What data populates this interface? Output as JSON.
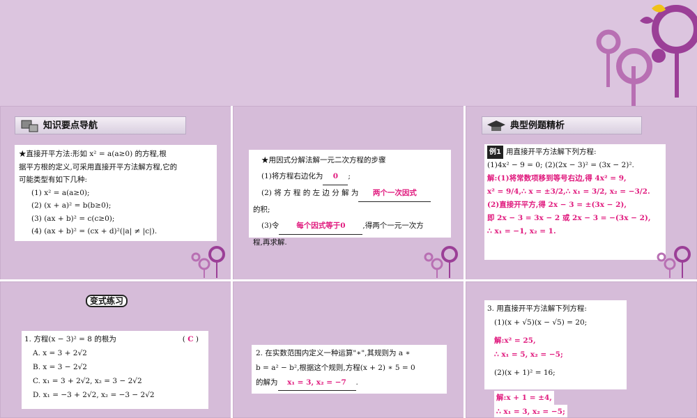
{
  "panel1": {
    "header": "知识要点导航",
    "lines": [
      "★直接开平方法:形如 x² = a(a≥0) 的方程,根",
      "据平方根的定义,可采用直接开平方法解方程,它的",
      "可能类型有如下几种:",
      "(1) x² = a(a≥0);",
      "(2) (x + a)² = b(b≥0);",
      "(3) (ax + b)² = c(c≥0);",
      "(4) (ax + b)² = (cx + d)²(|a| ≠ |c|)."
    ]
  },
  "panel2": {
    "title": "★用因式分解法解一元二次方程的步骤",
    "step1_prefix": "(1)将方程右边化为",
    "step1_blank": "0",
    "step1_suffix": ";",
    "step2_prefix": "(2) 将 方 程 的 左 边 分 解 为",
    "step2_blank": "两个一次因式",
    "step2_cont": "的积;",
    "step3_prefix": "(3)令",
    "step3_blank": "每个因式等于0",
    "step3_suffix": ",得两个一元一次方",
    "step3_cont": "程,再求解."
  },
  "panel3": {
    "header": "典型例题精析",
    "example_tag": "例1",
    "question": "用直接开平方法解下列方程:",
    "q_items": "(1)4x² − 9 = 0;        (2)(2x − 3)² = (3x − 2)².",
    "ans_lines": [
      "解:(1)将常数项移到等号右边,得 4x² = 9,",
      "x² = 9/4,∴ x = ±3/2,∴ x₁ = 3/2, x₂ = −3/2.",
      "(2)直接开平方,得 2x − 3 = ±(3x − 2),",
      "即 2x − 3 = 3x − 2 或 2x − 3 = −(3x − 2),",
      "∴ x₁ = −1, x₂ = 1."
    ]
  },
  "panel4": {
    "badge": "变式练习",
    "question": "1. 方程(x − 3)² = 8 的根为",
    "answer": "C",
    "options": [
      "A. x = 3 + 2√2",
      "B. x = 3 − 2√2",
      "C. x₁ = 3 + 2√2, x₂ = 3 − 2√2",
      "D. x₁ = −3 + 2√2, x₂ = −3 − 2√2"
    ]
  },
  "panel5": {
    "line1": "2. 在实数范围内定义一种运算\"∗\",其规则为 a ∗",
    "line2": "b = a² − b²,根据这个规则,方程(x + 2) ∗ 5 = 0",
    "line3_prefix": "的解为",
    "line3_blank": "x₁ = 3, x₂ = −7",
    "line3_suffix": "."
  },
  "panel6": {
    "title": "3. 用直接开平方法解下列方程:",
    "q1": "(1)(x + √5)(x − √5) = 20;",
    "a1_l1": "解:x² = 25,",
    "a1_l2": "∴ x₁ = 5, x₂ = −5;",
    "q2": "(2)(x + 1)² = 16;",
    "a2_l1": "解:x + 1 = ±4,",
    "a2_l2": "∴ x₁ = 3, x₂ = −5;"
  },
  "colors": {
    "background": "#d8c2dc",
    "answer": "#e0197d",
    "deco_purple": "#9b3f97"
  }
}
